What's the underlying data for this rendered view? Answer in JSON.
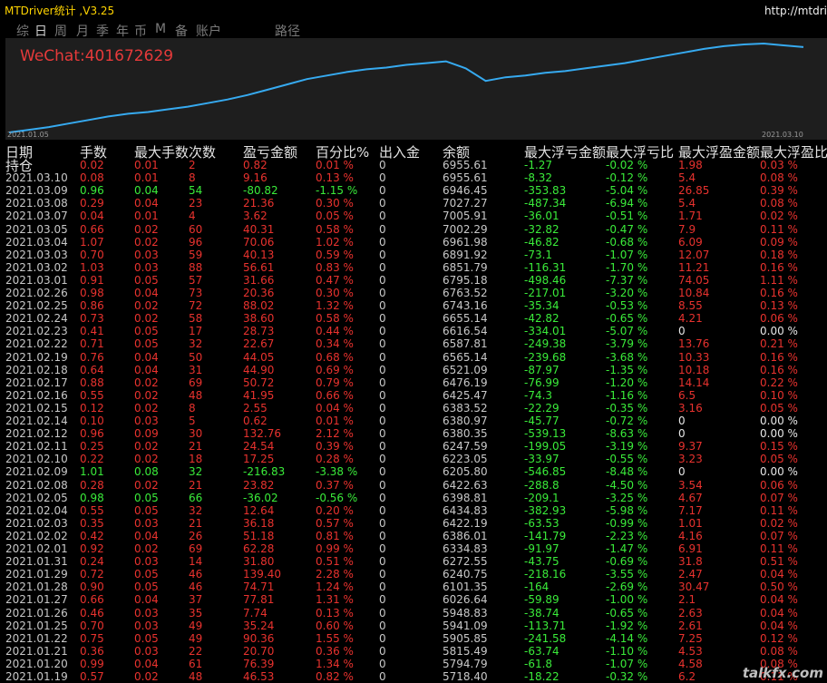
{
  "app": {
    "title": "MTDriver统计 ,V3.25",
    "url": "http://mtdri",
    "watermark": "talkfx.com"
  },
  "tabs": [
    "综",
    "日",
    "周",
    "月",
    "季",
    "年",
    "币",
    "M",
    "备",
    "账户",
    "路径"
  ],
  "active_tab": 1,
  "chart": {
    "wechat": "WeChat:401672629",
    "start_label": "2021.01.05",
    "end_label": "2021.03.10",
    "line_color": "#36aaf0"
  },
  "chart_data": {
    "type": "line",
    "title": "",
    "xlabel": "",
    "ylabel": "",
    "x": [
      "2021.01.05",
      "2021.03.10"
    ],
    "note_values": [
      0,
      0.03,
      0.06,
      0.1,
      0.14,
      0.18,
      0.21,
      0.23,
      0.26,
      0.29,
      0.33,
      0.37,
      0.42,
      0.48,
      0.54,
      0.6,
      0.64,
      0.68,
      0.71,
      0.73,
      0.76,
      0.78,
      0.8,
      0.72,
      0.58,
      0.62,
      0.64,
      0.67,
      0.69,
      0.72,
      0.75,
      0.78,
      0.82,
      0.86,
      0.9,
      0.94,
      0.97,
      0.99,
      1.0,
      0.98,
      0.96
    ]
  },
  "colors": {
    "red": "#e8322e",
    "green": "#3aeb3a",
    "white": "#e6e6e6",
    "gray": "#c8c8c8"
  },
  "headers": [
    "日期",
    "手数",
    "最大手数",
    "次数",
    "盈亏金额",
    "百分比%",
    "出入金",
    "余额",
    "最大浮亏金额",
    "最大浮亏比",
    "最大浮盈金额",
    "最大浮盈比"
  ],
  "rows": [
    {
      "d": "持仓",
      "lots": "0.02",
      "maxl": "0.01",
      "n": "2",
      "pl": "0.82",
      "pct": "0.01 %",
      "io": "0",
      "bal": "6955.61",
      "fl": "-1.27",
      "flp": "-0.02 %",
      "fp": "1.98",
      "fpp": "0.03 %",
      "c": "r"
    },
    {
      "d": "2021.03.10",
      "lots": "0.08",
      "maxl": "0.01",
      "n": "8",
      "pl": "9.16",
      "pct": "0.13 %",
      "io": "0",
      "bal": "6955.61",
      "fl": "-8.32",
      "flp": "-0.12 %",
      "fp": "5.4",
      "fpp": "0.08 %",
      "c": "r"
    },
    {
      "d": "2021.03.09",
      "lots": "0.96",
      "maxl": "0.04",
      "n": "54",
      "pl": "-80.82",
      "pct": "-1.15 %",
      "io": "0",
      "bal": "6946.45",
      "fl": "-353.83",
      "flp": "-5.04 %",
      "fp": "26.85",
      "fpp": "0.39 %",
      "c": "g"
    },
    {
      "d": "2021.03.08",
      "lots": "0.29",
      "maxl": "0.04",
      "n": "23",
      "pl": "21.36",
      "pct": "0.30 %",
      "io": "0",
      "bal": "7027.27",
      "fl": "-487.34",
      "flp": "-6.94 %",
      "fp": "5.4",
      "fpp": "0.08 %",
      "c": "r"
    },
    {
      "d": "2021.03.07",
      "lots": "0.04",
      "maxl": "0.01",
      "n": "4",
      "pl": "3.62",
      "pct": "0.05 %",
      "io": "0",
      "bal": "7005.91",
      "fl": "-36.01",
      "flp": "-0.51 %",
      "fp": "1.71",
      "fpp": "0.02 %",
      "c": "r"
    },
    {
      "d": "2021.03.05",
      "lots": "0.66",
      "maxl": "0.02",
      "n": "60",
      "pl": "40.31",
      "pct": "0.58 %",
      "io": "0",
      "bal": "7002.29",
      "fl": "-32.82",
      "flp": "-0.47 %",
      "fp": "7.9",
      "fpp": "0.11 %",
      "c": "r"
    },
    {
      "d": "2021.03.04",
      "lots": "1.07",
      "maxl": "0.02",
      "n": "96",
      "pl": "70.06",
      "pct": "1.02 %",
      "io": "0",
      "bal": "6961.98",
      "fl": "-46.82",
      "flp": "-0.68 %",
      "fp": "6.09",
      "fpp": "0.09 %",
      "c": "r"
    },
    {
      "d": "2021.03.03",
      "lots": "0.70",
      "maxl": "0.03",
      "n": "59",
      "pl": "40.13",
      "pct": "0.59 %",
      "io": "0",
      "bal": "6891.92",
      "fl": "-73.1",
      "flp": "-1.07 %",
      "fp": "12.07",
      "fpp": "0.18 %",
      "c": "r"
    },
    {
      "d": "2021.03.02",
      "lots": "1.03",
      "maxl": "0.03",
      "n": "88",
      "pl": "56.61",
      "pct": "0.83 %",
      "io": "0",
      "bal": "6851.79",
      "fl": "-116.31",
      "flp": "-1.70 %",
      "fp": "11.21",
      "fpp": "0.16 %",
      "c": "r"
    },
    {
      "d": "2021.03.01",
      "lots": "0.91",
      "maxl": "0.05",
      "n": "57",
      "pl": "31.66",
      "pct": "0.47 %",
      "io": "0",
      "bal": "6795.18",
      "fl": "-498.46",
      "flp": "-7.37 %",
      "fp": "74.05",
      "fpp": "1.11 %",
      "c": "r"
    },
    {
      "d": "2021.02.26",
      "lots": "0.98",
      "maxl": "0.04",
      "n": "73",
      "pl": "20.36",
      "pct": "0.30 %",
      "io": "0",
      "bal": "6763.52",
      "fl": "-217.01",
      "flp": "-3.20 %",
      "fp": "10.84",
      "fpp": "0.16 %",
      "c": "r"
    },
    {
      "d": "2021.02.25",
      "lots": "0.86",
      "maxl": "0.02",
      "n": "72",
      "pl": "88.02",
      "pct": "1.32 %",
      "io": "0",
      "bal": "6743.16",
      "fl": "-35.34",
      "flp": "-0.53 %",
      "fp": "8.55",
      "fpp": "0.13 %",
      "c": "r"
    },
    {
      "d": "2021.02.24",
      "lots": "0.73",
      "maxl": "0.02",
      "n": "58",
      "pl": "38.60",
      "pct": "0.58 %",
      "io": "0",
      "bal": "6655.14",
      "fl": "-42.82",
      "flp": "-0.65 %",
      "fp": "4.21",
      "fpp": "0.06 %",
      "c": "r"
    },
    {
      "d": "2021.02.23",
      "lots": "0.41",
      "maxl": "0.05",
      "n": "17",
      "pl": "28.73",
      "pct": "0.44 %",
      "io": "0",
      "bal": "6616.54",
      "fl": "-334.01",
      "flp": "-5.07 %",
      "fp": "0",
      "fpp": "0.00 %",
      "c": "r",
      "fw": 1
    },
    {
      "d": "2021.02.22",
      "lots": "0.71",
      "maxl": "0.05",
      "n": "32",
      "pl": "22.67",
      "pct": "0.34 %",
      "io": "0",
      "bal": "6587.81",
      "fl": "-249.38",
      "flp": "-3.79 %",
      "fp": "13.76",
      "fpp": "0.21 %",
      "c": "r"
    },
    {
      "d": "2021.02.19",
      "lots": "0.76",
      "maxl": "0.04",
      "n": "50",
      "pl": "44.05",
      "pct": "0.68 %",
      "io": "0",
      "bal": "6565.14",
      "fl": "-239.68",
      "flp": "-3.68 %",
      "fp": "10.33",
      "fpp": "0.16 %",
      "c": "r"
    },
    {
      "d": "2021.02.18",
      "lots": "0.64",
      "maxl": "0.04",
      "n": "31",
      "pl": "44.90",
      "pct": "0.69 %",
      "io": "0",
      "bal": "6521.09",
      "fl": "-87.97",
      "flp": "-1.35 %",
      "fp": "10.18",
      "fpp": "0.16 %",
      "c": "r"
    },
    {
      "d": "2021.02.17",
      "lots": "0.88",
      "maxl": "0.02",
      "n": "69",
      "pl": "50.72",
      "pct": "0.79 %",
      "io": "0",
      "bal": "6476.19",
      "fl": "-76.99",
      "flp": "-1.20 %",
      "fp": "14.14",
      "fpp": "0.22 %",
      "c": "r"
    },
    {
      "d": "2021.02.16",
      "lots": "0.55",
      "maxl": "0.02",
      "n": "48",
      "pl": "41.95",
      "pct": "0.66 %",
      "io": "0",
      "bal": "6425.47",
      "fl": "-74.3",
      "flp": "-1.16 %",
      "fp": "6.5",
      "fpp": "0.10 %",
      "c": "r"
    },
    {
      "d": "2021.02.15",
      "lots": "0.12",
      "maxl": "0.02",
      "n": "8",
      "pl": "2.55",
      "pct": "0.04 %",
      "io": "0",
      "bal": "6383.52",
      "fl": "-22.29",
      "flp": "-0.35 %",
      "fp": "3.16",
      "fpp": "0.05 %",
      "c": "r"
    },
    {
      "d": "2021.02.14",
      "lots": "0.10",
      "maxl": "0.03",
      "n": "5",
      "pl": "0.62",
      "pct": "0.01 %",
      "io": "0",
      "bal": "6380.97",
      "fl": "-45.77",
      "flp": "-0.72 %",
      "fp": "0",
      "fpp": "0.00 %",
      "c": "r",
      "fw": 1
    },
    {
      "d": "2021.02.12",
      "lots": "0.96",
      "maxl": "0.09",
      "n": "30",
      "pl": "132.76",
      "pct": "2.12 %",
      "io": "0",
      "bal": "6380.35",
      "fl": "-539.13",
      "flp": "-8.63 %",
      "fp": "0",
      "fpp": "0.00 %",
      "c": "r",
      "fw": 1
    },
    {
      "d": "2021.02.11",
      "lots": "0.25",
      "maxl": "0.02",
      "n": "21",
      "pl": "24.54",
      "pct": "0.39 %",
      "io": "0",
      "bal": "6247.59",
      "fl": "-199.05",
      "flp": "-3.19 %",
      "fp": "9.37",
      "fpp": "0.15 %",
      "c": "r"
    },
    {
      "d": "2021.02.10",
      "lots": "0.22",
      "maxl": "0.02",
      "n": "18",
      "pl": "17.25",
      "pct": "0.28 %",
      "io": "0",
      "bal": "6223.05",
      "fl": "-33.97",
      "flp": "-0.55 %",
      "fp": "3.23",
      "fpp": "0.05 %",
      "c": "r"
    },
    {
      "d": "2021.02.09",
      "lots": "1.01",
      "maxl": "0.08",
      "n": "32",
      "pl": "-216.83",
      "pct": "-3.38 %",
      "io": "0",
      "bal": "6205.80",
      "fl": "-546.85",
      "flp": "-8.48 %",
      "fp": "0",
      "fpp": "0.00 %",
      "c": "g",
      "fw": 1
    },
    {
      "d": "2021.02.08",
      "lots": "0.28",
      "maxl": "0.02",
      "n": "21",
      "pl": "23.82",
      "pct": "0.37 %",
      "io": "0",
      "bal": "6422.63",
      "fl": "-288.8",
      "flp": "-4.50 %",
      "fp": "3.54",
      "fpp": "0.06 %",
      "c": "r"
    },
    {
      "d": "2021.02.05",
      "lots": "0.98",
      "maxl": "0.05",
      "n": "66",
      "pl": "-36.02",
      "pct": "-0.56 %",
      "io": "0",
      "bal": "6398.81",
      "fl": "-209.1",
      "flp": "-3.25 %",
      "fp": "4.67",
      "fpp": "0.07 %",
      "c": "g"
    },
    {
      "d": "2021.02.04",
      "lots": "0.55",
      "maxl": "0.05",
      "n": "32",
      "pl": "12.64",
      "pct": "0.20 %",
      "io": "0",
      "bal": "6434.83",
      "fl": "-382.93",
      "flp": "-5.98 %",
      "fp": "7.17",
      "fpp": "0.11 %",
      "c": "r"
    },
    {
      "d": "2021.02.03",
      "lots": "0.35",
      "maxl": "0.03",
      "n": "21",
      "pl": "36.18",
      "pct": "0.57 %",
      "io": "0",
      "bal": "6422.19",
      "fl": "-63.53",
      "flp": "-0.99 %",
      "fp": "1.01",
      "fpp": "0.02 %",
      "c": "r"
    },
    {
      "d": "2021.02.02",
      "lots": "0.42",
      "maxl": "0.04",
      "n": "26",
      "pl": "51.18",
      "pct": "0.81 %",
      "io": "0",
      "bal": "6386.01",
      "fl": "-141.79",
      "flp": "-2.23 %",
      "fp": "4.16",
      "fpp": "0.07 %",
      "c": "r"
    },
    {
      "d": "2021.02.01",
      "lots": "0.92",
      "maxl": "0.02",
      "n": "69",
      "pl": "62.28",
      "pct": "0.99 %",
      "io": "0",
      "bal": "6334.83",
      "fl": "-91.97",
      "flp": "-1.47 %",
      "fp": "6.91",
      "fpp": "0.11 %",
      "c": "r"
    },
    {
      "d": "2021.01.31",
      "lots": "0.24",
      "maxl": "0.03",
      "n": "14",
      "pl": "31.80",
      "pct": "0.51 %",
      "io": "0",
      "bal": "6272.55",
      "fl": "-43.75",
      "flp": "-0.69 %",
      "fp": "31.8",
      "fpp": "0.51 %",
      "c": "r"
    },
    {
      "d": "2021.01.29",
      "lots": "0.72",
      "maxl": "0.05",
      "n": "46",
      "pl": "139.40",
      "pct": "2.28 %",
      "io": "0",
      "bal": "6240.75",
      "fl": "-218.16",
      "flp": "-3.55 %",
      "fp": "2.47",
      "fpp": "0.04 %",
      "c": "r"
    },
    {
      "d": "2021.01.28",
      "lots": "0.90",
      "maxl": "0.05",
      "n": "46",
      "pl": "74.71",
      "pct": "1.24 %",
      "io": "0",
      "bal": "6101.35",
      "fl": "-164",
      "flp": "-2.69 %",
      "fp": "30.47",
      "fpp": "0.50 %",
      "c": "r"
    },
    {
      "d": "2021.01.27",
      "lots": "0.66",
      "maxl": "0.04",
      "n": "37",
      "pl": "77.81",
      "pct": "1.31 %",
      "io": "0",
      "bal": "6026.64",
      "fl": "-59.89",
      "flp": "-1.00 %",
      "fp": "2.1",
      "fpp": "0.04 %",
      "c": "r"
    },
    {
      "d": "2021.01.26",
      "lots": "0.46",
      "maxl": "0.03",
      "n": "35",
      "pl": "7.74",
      "pct": "0.13 %",
      "io": "0",
      "bal": "5948.83",
      "fl": "-38.74",
      "flp": "-0.65 %",
      "fp": "2.63",
      "fpp": "0.04 %",
      "c": "r"
    },
    {
      "d": "2021.01.25",
      "lots": "0.70",
      "maxl": "0.03",
      "n": "49",
      "pl": "35.24",
      "pct": "0.60 %",
      "io": "0",
      "bal": "5941.09",
      "fl": "-113.71",
      "flp": "-1.92 %",
      "fp": "2.61",
      "fpp": "0.04 %",
      "c": "r"
    },
    {
      "d": "2021.01.22",
      "lots": "0.75",
      "maxl": "0.05",
      "n": "49",
      "pl": "90.36",
      "pct": "1.55 %",
      "io": "0",
      "bal": "5905.85",
      "fl": "-241.58",
      "flp": "-4.14 %",
      "fp": "7.25",
      "fpp": "0.12 %",
      "c": "r"
    },
    {
      "d": "2021.01.21",
      "lots": "0.36",
      "maxl": "0.03",
      "n": "22",
      "pl": "20.70",
      "pct": "0.36 %",
      "io": "0",
      "bal": "5815.49",
      "fl": "-63.74",
      "flp": "-1.10 %",
      "fp": "4.53",
      "fpp": "0.08 %",
      "c": "r"
    },
    {
      "d": "2021.01.20",
      "lots": "0.99",
      "maxl": "0.04",
      "n": "61",
      "pl": "76.39",
      "pct": "1.34 %",
      "io": "0",
      "bal": "5794.79",
      "fl": "-61.8",
      "flp": "-1.07 %",
      "fp": "4.58",
      "fpp": "0.08 %",
      "c": "r"
    },
    {
      "d": "2021.01.19",
      "lots": "0.57",
      "maxl": "0.02",
      "n": "48",
      "pl": "46.53",
      "pct": "0.82 %",
      "io": "0",
      "bal": "5718.40",
      "fl": "-18.22",
      "flp": "-0.32 %",
      "fp": "6.2",
      "fpp": "0.11 %",
      "c": "r"
    }
  ]
}
